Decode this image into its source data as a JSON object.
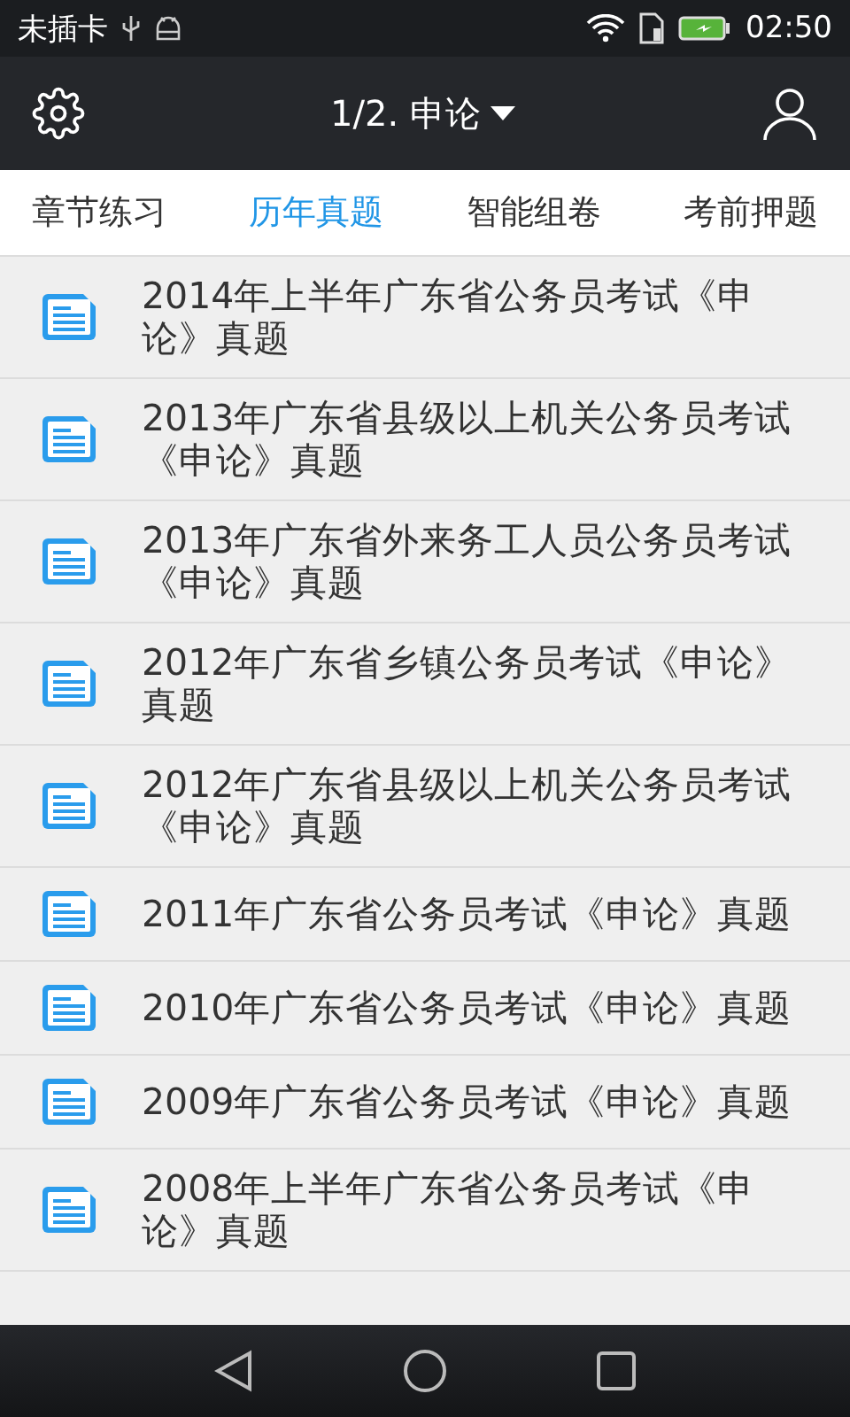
{
  "status_bar": {
    "carrier": "未插卡",
    "time": "02:50"
  },
  "app_bar": {
    "title": "1/2. 申论"
  },
  "tabs": [
    {
      "label": "章节练习",
      "selected": false
    },
    {
      "label": "历年真题",
      "selected": true
    },
    {
      "label": "智能组卷",
      "selected": false
    },
    {
      "label": "考前押题",
      "selected": false
    }
  ],
  "papers": [
    {
      "title": "2014年上半年广东省公务员考试《申论》真题"
    },
    {
      "title": "2013年广东省县级以上机关公务员考试《申论》真题"
    },
    {
      "title": "2013年广东省外来务工人员公务员考试《申论》真题"
    },
    {
      "title": "2012年广东省乡镇公务员考试《申论》真题"
    },
    {
      "title": "2012年广东省县级以上机关公务员考试《申论》真题"
    },
    {
      "title": "2011年广东省公务员考试《申论》真题"
    },
    {
      "title": "2010年广东省公务员考试《申论》真题"
    },
    {
      "title": "2009年广东省公务员考试《申论》真题"
    },
    {
      "title": "2008年上半年广东省公务员考试《申论》真题"
    }
  ]
}
